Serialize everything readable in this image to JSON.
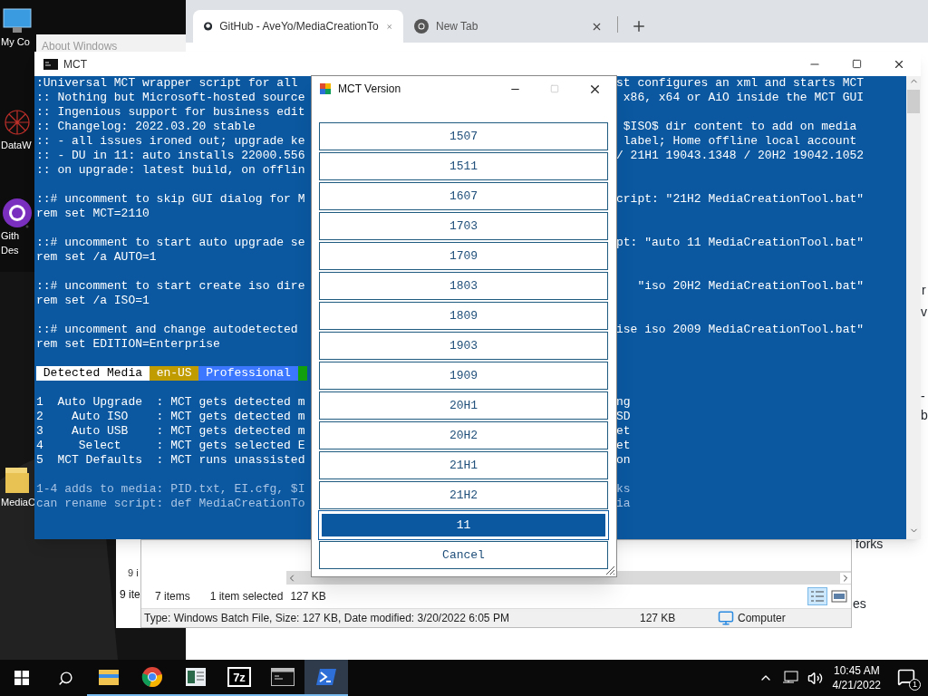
{
  "desktop_icons": [
    {
      "kind": "computer",
      "lines": [
        "My Co"
      ]
    },
    {
      "kind": "network",
      "lines": [
        "DataW"
      ]
    },
    {
      "kind": "github",
      "lines": [
        "Gith",
        "Des"
      ]
    },
    {
      "kind": "folder",
      "lines": [
        "MediaC"
      ]
    }
  ],
  "browser": {
    "tabs": [
      {
        "title": "GitHub - AveYo/MediaCreationTo",
        "selected": true
      },
      {
        "title": "New Tab",
        "selected": false
      }
    ],
    "page_fragments": [
      "r",
      "v",
      "-b",
      "forks",
      "es"
    ]
  },
  "about_window": {
    "title": "About Windows"
  },
  "back_window": {
    "status": [
      "9 i",
      "9 ite"
    ]
  },
  "explorer": {
    "item_count": "7 items",
    "selection": "1 item selected",
    "selection_size": "127 KB",
    "details": "Type: Windows Batch File, Size: 127 KB, Date modified: 3/20/2022 6:05 PM",
    "size": "127 KB",
    "location": "Computer"
  },
  "console": {
    "title": "MCT",
    "content": [
      {
        "kind": "lines",
        "dim": false,
        "lines": [
          {
            "left": ":Universal MCT wrapper script for all",
            "right": "st configures an xml and starts MCT"
          },
          {
            "left": ":: Nothing but Microsoft-hosted source",
            "right": " x86, x64 or AiO inside the MCT GUI"
          },
          {
            "left": ":: Ingenious support for business edit"
          },
          {
            "left": ":: Changelog: 2022.03.20 stable",
            "right": " $ISO$ dir content to add on media"
          },
          {
            "left": ":: - all issues ironed out; upgrade ke",
            "right": " label; Home offline local account"
          },
          {
            "left": ":: - DU in 11: auto installs 22000.556",
            "right": "/ 21H1 19043.1348 / 20H2 19042.1052"
          },
          {
            "left": ":: on upgrade: latest build, on offlin"
          }
        ]
      },
      {
        "kind": "lines",
        "dim": false,
        "lines": [
          {
            "left": "::# uncomment to skip GUI dialog for M",
            "right": "cript: \"21H2 MediaCreationTool.bat\""
          },
          {
            "left": "rem set MCT=2110"
          }
        ]
      },
      {
        "kind": "lines",
        "dim": false,
        "lines": [
          {
            "left": "::# uncomment to start auto upgrade se",
            "right": "pt: \"auto 11 MediaCreationTool.bat\""
          },
          {
            "left": "rem set /a AUTO=1"
          }
        ]
      },
      {
        "kind": "lines",
        "dim": false,
        "lines": [
          {
            "left": "::# uncomment to start create iso dire",
            "right": "   \"iso 20H2 MediaCreationTool.bat\""
          },
          {
            "left": "rem set /a ISO=1"
          }
        ]
      },
      {
        "kind": "lines",
        "dim": false,
        "lines": [
          {
            "left": "::# uncomment and change autodetected",
            "right": "ise iso 2009 MediaCreationTool.bat\""
          },
          {
            "left": "rem set EDITION=Enterprise"
          }
        ]
      },
      {
        "kind": "media_bar",
        "segments": [
          {
            "text": " Detected Media ",
            "color": "#ffffff"
          },
          {
            "text": " en-US ",
            "color": "#c19c00"
          },
          {
            "text": " Professional ",
            "color": "#3b78ff"
          },
          {
            "color": "#13a10e"
          }
        ]
      },
      {
        "kind": "lines",
        "dim": false,
        "lines": [
          {
            "left": "1  Auto Upgrade  : MCT gets detected m",
            "right": "ng"
          },
          {
            "left": "2    Auto ISO    : MCT gets detected m",
            "right": "SD"
          },
          {
            "left": "3    Auto USB    : MCT gets detected m",
            "right": "et"
          },
          {
            "left": "4     Select     : MCT gets selected E",
            "right": "et"
          },
          {
            "left": "5  MCT Defaults  : MCT runs unassisted",
            "right": "on"
          }
        ]
      },
      {
        "kind": "lines",
        "dim": true,
        "lines": [
          {
            "left": "1-4 adds to media: PID.txt, EI.cfg, $I",
            "right": "ks"
          },
          {
            "left": "can rename script: def MediaCreationTo",
            "right": "ia"
          }
        ]
      }
    ]
  },
  "dialog": {
    "title": "MCT Version",
    "maximize_disabled": true,
    "options": [
      {
        "label": "1507",
        "selected": false
      },
      {
        "label": "1511",
        "selected": false
      },
      {
        "label": "1607",
        "selected": false
      },
      {
        "label": "1703",
        "selected": false
      },
      {
        "label": "1709",
        "selected": false
      },
      {
        "label": "1803",
        "selected": false
      },
      {
        "label": "1809",
        "selected": false
      },
      {
        "label": "1903",
        "selected": false
      },
      {
        "label": "1909",
        "selected": false
      },
      {
        "label": "20H1",
        "selected": false
      },
      {
        "label": "20H2",
        "selected": false
      },
      {
        "label": "21H1",
        "selected": false
      },
      {
        "label": "21H2",
        "selected": false
      },
      {
        "label": "11",
        "selected": true
      }
    ],
    "cancel": "Cancel"
  },
  "taskbar": {
    "apps": [
      {
        "kind": "explorer",
        "selected": false
      },
      {
        "kind": "chrome",
        "selected": false
      },
      {
        "kind": "reader",
        "selected": false
      },
      {
        "kind": "archiver",
        "label": "7z",
        "selected": false
      },
      {
        "kind": "terminal",
        "selected": false
      },
      {
        "kind": "powershell",
        "selected": true
      }
    ],
    "time": "10:45 AM",
    "date": "4/21/2022",
    "notifications": "1"
  }
}
